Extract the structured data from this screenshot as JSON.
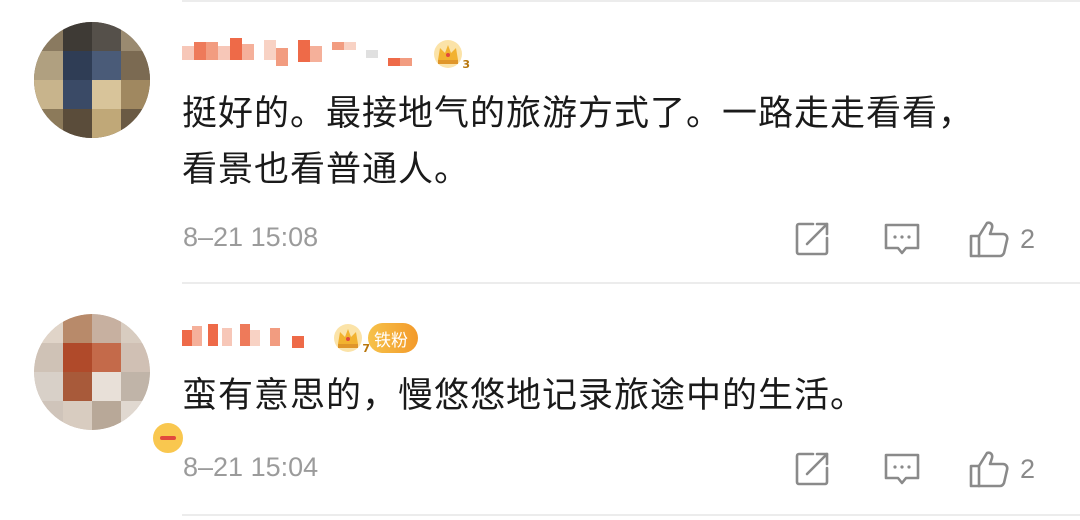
{
  "comments": [
    {
      "crown_level": "3",
      "text": "挺好的。最接地气的旅游方式了。一路走走看看，看景也看普通人。",
      "timestamp": "8–21 15:08",
      "likes": "2"
    },
    {
      "crown_level": "7",
      "fan_badge": "铁粉",
      "text": "蛮有意思的，慢悠悠地记录旅途中的生活。",
      "timestamp": "8–21 15:04",
      "likes": "2"
    }
  ],
  "icons": {
    "share": "share-icon",
    "reply": "comment-icon",
    "like": "thumbs-up-icon",
    "crown": "crown-icon"
  },
  "colors": {
    "text": "#1a1a1a",
    "meta": "#9b9b9b",
    "crown": "#f2b230",
    "fan_badge": "#f39a2b"
  }
}
